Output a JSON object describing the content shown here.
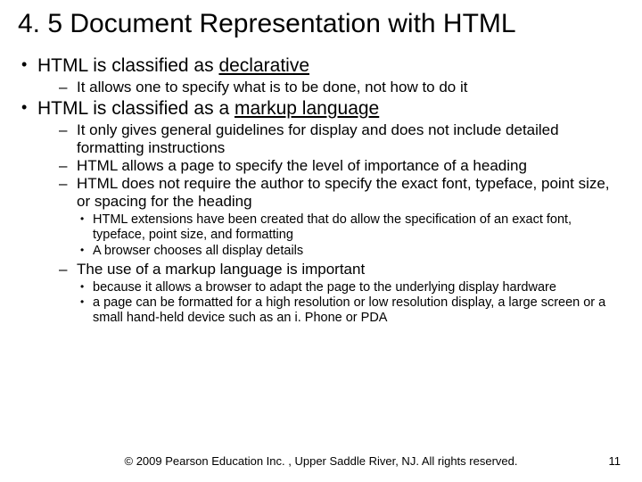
{
  "title": "4. 5  Document Representation with HTML",
  "b1": {
    "text_a": "HTML is classified as ",
    "text_b": "declarative",
    "sub1": "It allows one to specify what is to be done, not how to do it"
  },
  "b2": {
    "text_a": "HTML is classified as a ",
    "text_b": "markup language",
    "sub1": "It only gives general guidelines for display and does not include detailed formatting instructions",
    "sub2": "HTML allows a page to specify the level of importance of a heading",
    "sub3": "HTML does not require the author to specify the exact font, typeface, point size, or spacing for the heading",
    "sub3_a": "HTML extensions have been created that do allow the specification of an exact font, typeface, point size, and formatting",
    "sub3_b": "A browser chooses all display details",
    "sub4": "The use of a markup language is important",
    "sub4_a": "because it allows a browser to adapt the page to the underlying display hardware",
    "sub4_b": "a page can be formatted for a high resolution or low resolution display, a large screen or a small hand-held device such as an i. Phone or PDA"
  },
  "footer": "© 2009 Pearson Education Inc. , Upper Saddle River, NJ.  All rights reserved.",
  "page": "11"
}
